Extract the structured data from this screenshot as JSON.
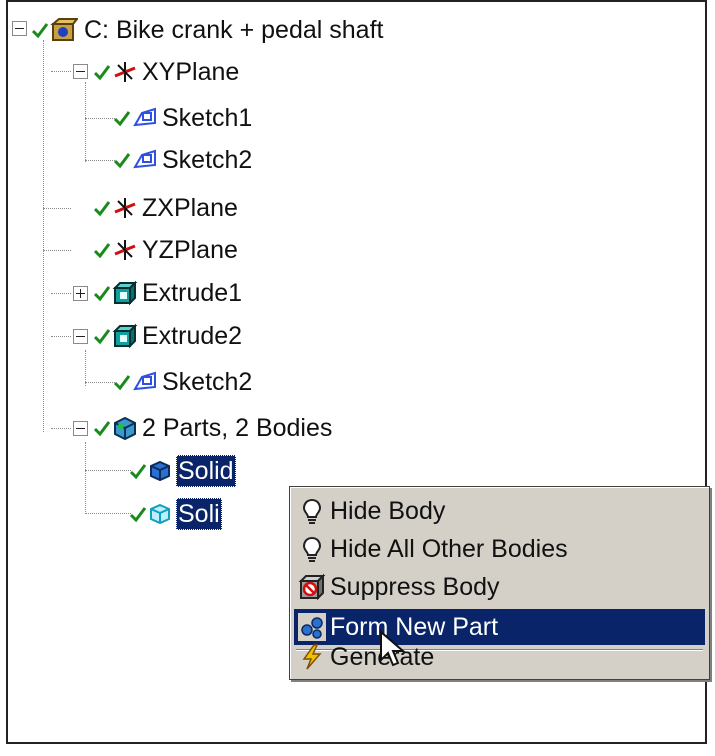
{
  "tree": {
    "root": {
      "label": "C: Bike crank + pedal shaft"
    },
    "items": [
      {
        "label": "XYPlane"
      },
      {
        "label": "Sketch1"
      },
      {
        "label": "Sketch2"
      },
      {
        "label": "ZXPlane"
      },
      {
        "label": "YZPlane"
      },
      {
        "label": "Extrude1"
      },
      {
        "label": "Extrude2"
      },
      {
        "label": "Sketch2"
      },
      {
        "label": "2 Parts, 2 Bodies"
      },
      {
        "label": "Solid"
      },
      {
        "label": "Soli"
      }
    ]
  },
  "context_menu": {
    "items": [
      {
        "label": "Hide Body",
        "icon": "lightbulb-icon"
      },
      {
        "label": "Hide All Other Bodies",
        "icon": "lightbulb-icon"
      },
      {
        "label": "Suppress Body",
        "icon": "suppress-body-icon"
      },
      {
        "label": "Form New Part",
        "icon": "form-new-part-icon",
        "highlighted": true
      },
      {
        "label": "Generate",
        "icon": "lightning-icon"
      }
    ]
  },
  "colors": {
    "selection": "#0a246a",
    "menu_bg": "#d4d0c8",
    "check": "#1a8a1a",
    "sketch_icon": "#3050e0",
    "extrude_icon": "#10a0a0"
  }
}
